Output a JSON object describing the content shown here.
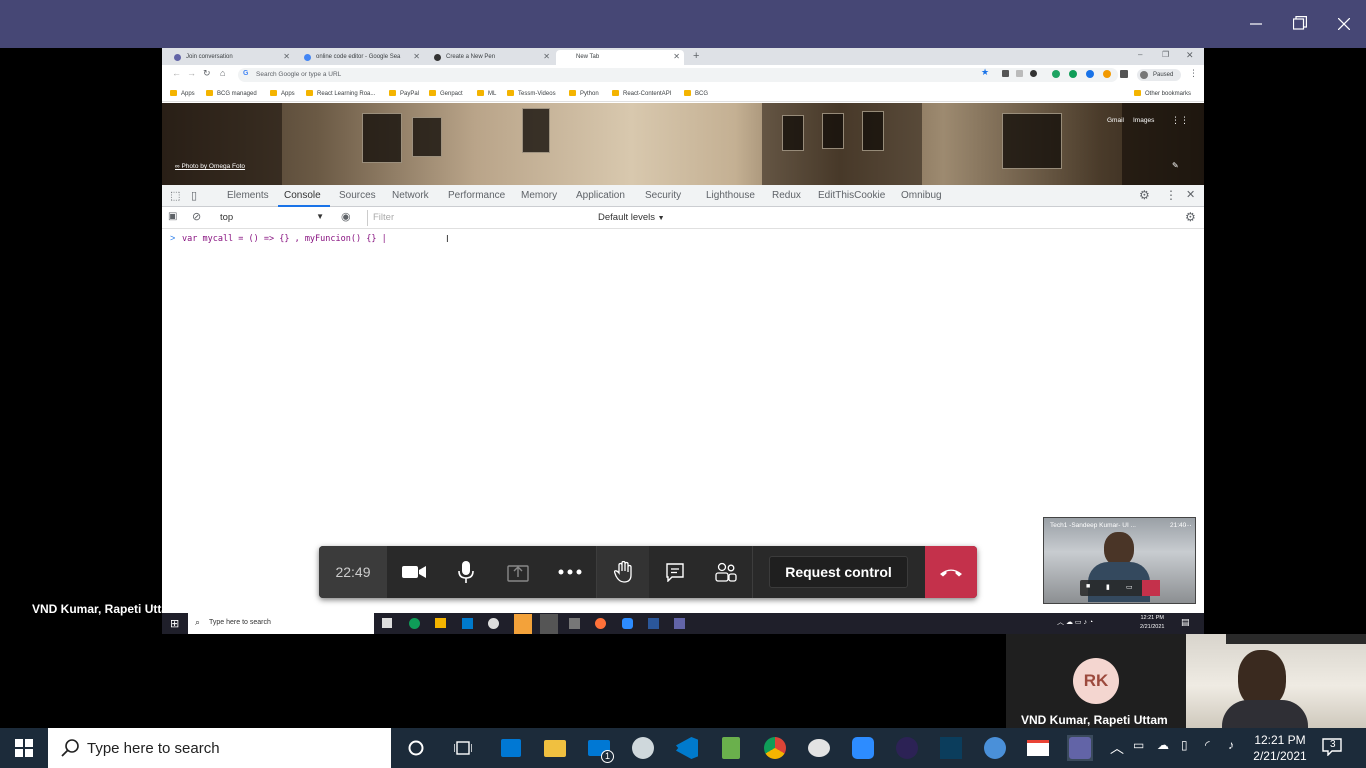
{
  "remote_window": {
    "tabs": [
      {
        "label": "Join conversation",
        "color": "#6264a7"
      },
      {
        "label": "online code editor - Google Sea",
        "color": "#4285f4"
      },
      {
        "label": "Create a New Pen",
        "color": "#333333"
      },
      {
        "label": "New Tab",
        "color": "#ffffff"
      }
    ],
    "new_tab_symbol": "+",
    "omnibox_placeholder": "Search Google or type a URL",
    "profile_label": "Paused",
    "bookmarks": [
      "Apps",
      "BCG managed",
      "Apps",
      "React Learning Roa...",
      "PayPal",
      "Genpact",
      "ML",
      "Tessm-Videos",
      "Python",
      "React-ContentAPI",
      "BCG"
    ],
    "other_bookmarks": "Other bookmarks",
    "ntp_links": [
      "Gmail",
      "Images"
    ],
    "photo_credit": "Photo by Omega Foto",
    "devtools_tabs": [
      "Elements",
      "Console",
      "Sources",
      "Network",
      "Performance",
      "Memory",
      "Application",
      "Security",
      "Lighthouse",
      "Redux",
      "EditThisCookie",
      "Omnibug"
    ],
    "active_devtools_tab": "Console",
    "context_select": "top",
    "filter_placeholder": "Filter",
    "levels": "Default levels",
    "console_prompt": ">",
    "console_input": "var mycall = () => {} , myFuncion() {} |",
    "taskbar_search": "Type here to search",
    "taskbar_time": "12:21 PM",
    "taskbar_date": "2/21/2021"
  },
  "meeting": {
    "timer": "22:49",
    "request_control": "Request control",
    "presenter_name": "VND Kumar, Rapeti Uttam",
    "thumbnail_title": "Tech1 -Sandeep Kumar- UI ...",
    "thumbnail_time": "21:40"
  },
  "participant": {
    "initials": "RK",
    "name": "VND Kumar, Rapeti Uttam",
    "avatar_color": "#f4d6d0",
    "initials_color": "#9c4a3d"
  },
  "taskbar": {
    "search_placeholder": "Type here to search",
    "time": "12:21 PM",
    "date": "2/21/2021",
    "notification_count": "3",
    "mail_badge": "1"
  },
  "colors": {
    "teams_purple": "#464775",
    "hangup_red": "#c4314b",
    "devtools_accent": "#1a73e8"
  }
}
